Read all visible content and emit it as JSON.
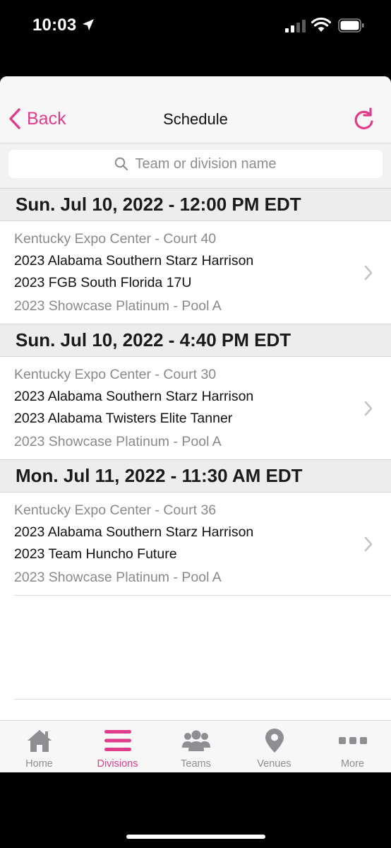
{
  "status_bar": {
    "time": "10:03"
  },
  "nav": {
    "back_label": "Back",
    "title": "Schedule"
  },
  "search": {
    "placeholder": "Team or division name"
  },
  "sections": [
    {
      "header": "Sun. Jul 10, 2022 - 12:00 PM EDT",
      "game": {
        "venue": "Kentucky Expo Center - Court 40",
        "team1": "2023 Alabama Southern Starz Harrison",
        "team2": "2023 FGB South Florida 17U",
        "division": "2023 Showcase Platinum - Pool A"
      }
    },
    {
      "header": "Sun. Jul 10, 2022 - 4:40 PM EDT",
      "game": {
        "venue": "Kentucky Expo Center - Court 30",
        "team1": "2023 Alabama Southern Starz Harrison",
        "team2": "2023 Alabama Twisters Elite Tanner",
        "division": "2023 Showcase Platinum - Pool A"
      }
    },
    {
      "header": "Mon. Jul 11, 2022 - 11:30 AM EDT",
      "game": {
        "venue": "Kentucky Expo Center - Court 36",
        "team1": "2023 Alabama Southern Starz Harrison",
        "team2": "2023 Team Huncho Future",
        "division": "2023 Showcase Platinum - Pool A"
      }
    }
  ],
  "tabs": [
    {
      "label": "Home",
      "icon": "home-icon",
      "active": false
    },
    {
      "label": "Divisions",
      "icon": "list-icon",
      "active": true
    },
    {
      "label": "Teams",
      "icon": "people-icon",
      "active": false
    },
    {
      "label": "Venues",
      "icon": "map-pin-icon",
      "active": false
    },
    {
      "label": "More",
      "icon": "more-dots-icon",
      "active": false
    }
  ],
  "colors": {
    "accent": "#e03c8a",
    "inactive": "#8e8e93",
    "section_bg": "#ededee"
  }
}
